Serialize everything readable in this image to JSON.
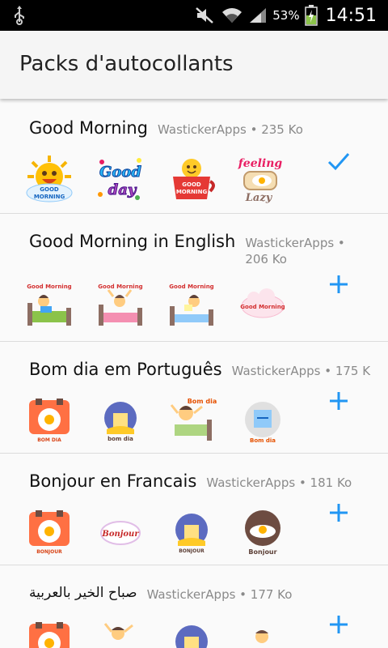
{
  "status_bar": {
    "battery_percent": "53%",
    "time": "14:51",
    "icons": [
      "usb-icon",
      "mute-icon",
      "wifi-icon",
      "signal-icon",
      "battery-icon"
    ]
  },
  "app_bar": {
    "title": "Packs d'autocollants"
  },
  "colors": {
    "accent": "#2196f3",
    "app_bar_bg": "#f5f5f5",
    "status_bar_bg": "#000000"
  },
  "packs": [
    {
      "name": "Good Morning",
      "meta": "WastickerApps • 235 Ko",
      "action": "added-check-icon"
    },
    {
      "name": "Good Morning in English",
      "meta": "WastickerApps • 206 Ko",
      "action": "add-icon"
    },
    {
      "name": "Bom dia em Português",
      "meta": "WastickerApps • 175 K",
      "action": "add-icon"
    },
    {
      "name": "Bonjour en Francais",
      "meta": "WastickerApps • 181 Ko",
      "action": "add-icon"
    },
    {
      "name": "صباح الخير بالعربية",
      "meta": "WastickerApps • 177 Ko",
      "action": "add-icon"
    }
  ],
  "sticker_texts": {
    "good_morning_sun": "GOOD MORNING",
    "good_day": "Good day",
    "good_morning_cup": "GOOD MORNING",
    "feeling_lazy": "feeling Lazy",
    "gm_label": "Good Morning",
    "bom_dia": "bom dia",
    "bom_dia_short": "BOM DIA",
    "bom_dia_sign": "Bom dia",
    "bonjour": "BONJOUR",
    "bonjour_sign": "Bonjour"
  }
}
